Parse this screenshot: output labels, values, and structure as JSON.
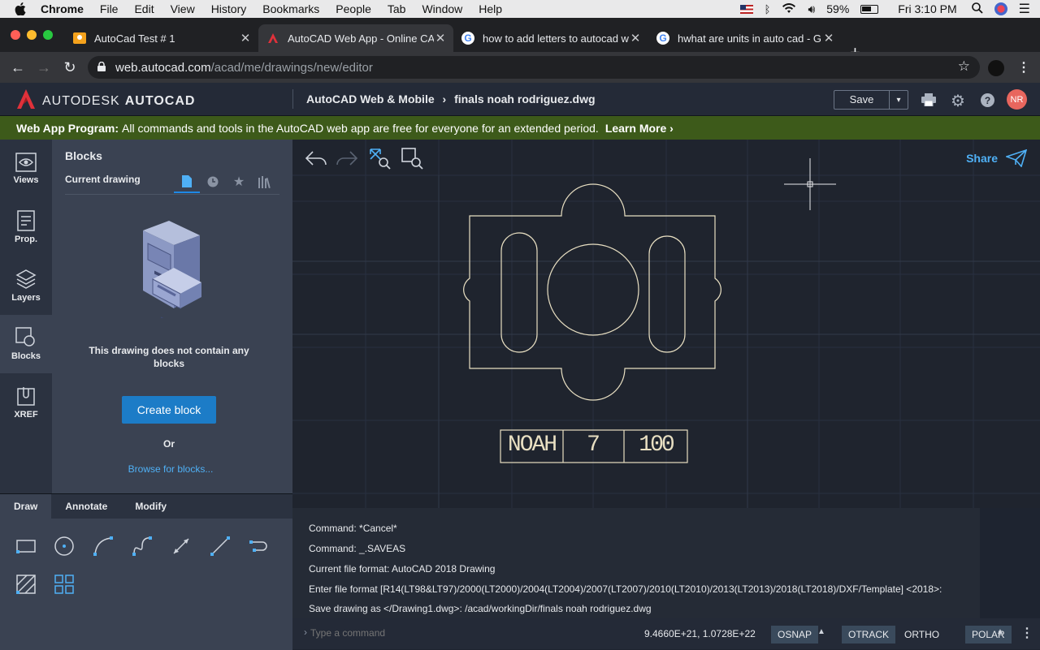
{
  "menubar": {
    "app": "Chrome",
    "items": [
      "File",
      "Edit",
      "View",
      "History",
      "Bookmarks",
      "People",
      "Tab",
      "Window",
      "Help"
    ],
    "battery": "59%",
    "clock": "Fri 3:10 PM"
  },
  "tabs": [
    {
      "title": "AutoCad Test # 1"
    },
    {
      "title": "AutoCAD Web App - Online CA"
    },
    {
      "title": "how to add letters to autocad w"
    },
    {
      "title": "hwhat are units in auto cad - G"
    }
  ],
  "address": {
    "host": "web.autocad.com",
    "path": "/acad/me/drawings/new/editor"
  },
  "header": {
    "logo_text": "AUTODESK",
    "logo_product": "AUTOCAD",
    "crumb_root": "AutoCAD Web & Mobile",
    "crumb_sep": "›",
    "crumb_file": "finals noah rodriguez.dwg",
    "save_label": "Save",
    "avatar": "NR"
  },
  "banner": {
    "label": "Web App Program:",
    "text": "All commands and tools in the AutoCAD web app are free for everyone for an extended period.",
    "link": "Learn More ›"
  },
  "rail": [
    {
      "label": "Views",
      "icon": "eye-icon"
    },
    {
      "label": "Prop.",
      "icon": "properties-icon"
    },
    {
      "label": "Layers",
      "icon": "layers-icon"
    },
    {
      "label": "Blocks",
      "icon": "blocks-icon"
    },
    {
      "label": "XREF",
      "icon": "xref-icon"
    }
  ],
  "panel": {
    "title": "Blocks",
    "subtitle": "Current drawing",
    "empty_text": "This drawing does not contain any blocks",
    "create_button": "Create block",
    "or_text": "Or",
    "browse_link": "Browse for blocks..."
  },
  "tools": {
    "tabs": [
      "Draw",
      "Annotate",
      "Modify"
    ],
    "active_tab": "Draw"
  },
  "canvas": {
    "share_label": "Share",
    "title_block": [
      "NOAH",
      "7",
      "100"
    ]
  },
  "command": {
    "lines": [
      "Command: *Cancel*",
      "Command: _.SAVEAS",
      "Current file format: AutoCAD 2018 Drawing",
      "Enter file format [R14(LT98&LT97)/2000(LT2000)/2004(LT2004)/2007(LT2007)/2010(LT2010)/2013(LT2013)/2018(LT2018)/DXF/Template] <2018>:",
      "Save drawing as </Drawing1.dwg>: /acad/workingDir/finals noah rodriguez.dwg"
    ],
    "placeholder": "Type a command"
  },
  "status": {
    "coords": "9.4660E+21, 1.0728E+22",
    "osnap": "OSNAP",
    "otrack": "OTRACK",
    "ortho": "ORTHO",
    "polar": "POLAR"
  }
}
